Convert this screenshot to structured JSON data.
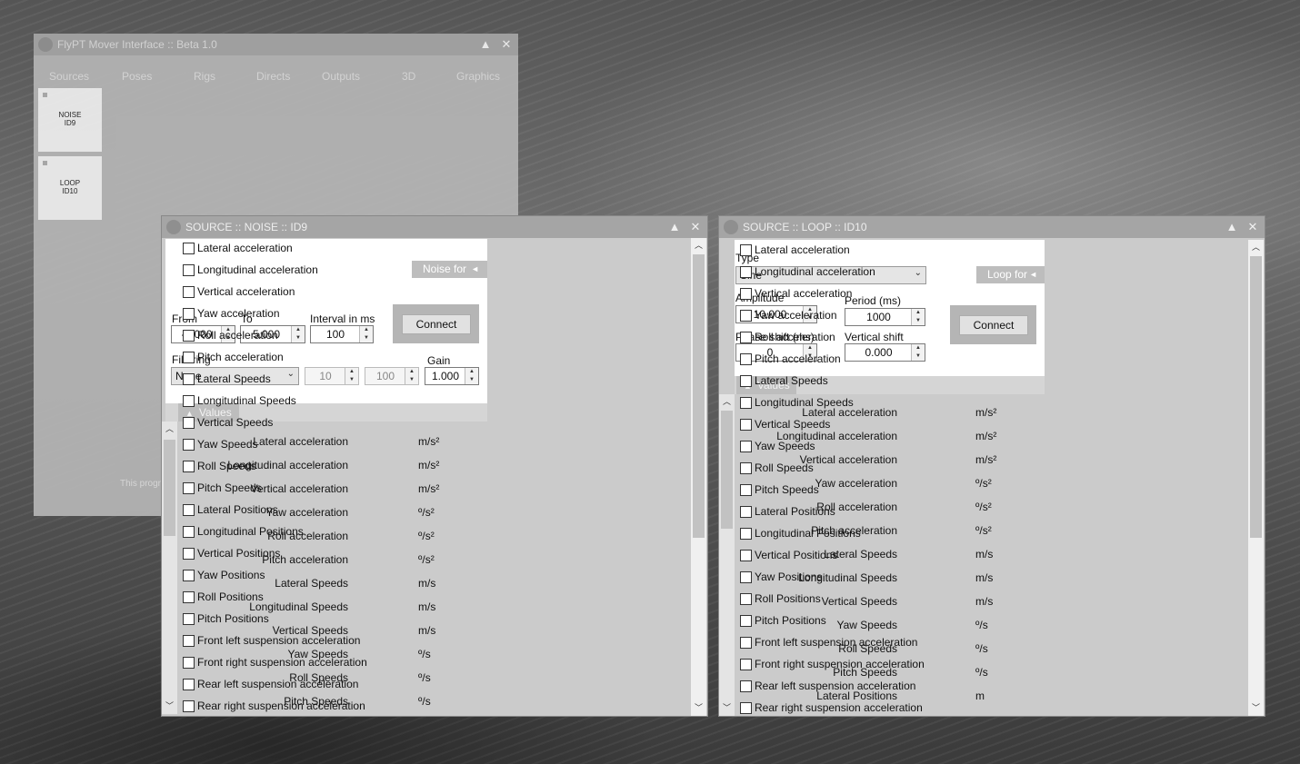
{
  "main_window": {
    "title": "FlyPT Mover Interface :: Beta 1.0",
    "tabs": [
      "Sources",
      "Poses",
      "Rigs",
      "Directs",
      "Outputs",
      "3D",
      "Graphics"
    ],
    "sources": [
      {
        "line1": "NOISE",
        "line2": "ID9"
      },
      {
        "line1": "LOOP",
        "line2": "ID10"
      }
    ],
    "footer": "This progra"
  },
  "icons": {
    "up": "▲",
    "close": "✕",
    "down": "⌄",
    "triangle_left": "◄",
    "tri_up": "▲",
    "tri_down": "▼",
    "scroll_up": "︿",
    "scroll_down": "﹀"
  },
  "noise": {
    "title": "SOURCE :: NOISE :: ID9",
    "noise_for": "Noise for",
    "from_label": "From",
    "from": "-5.000",
    "to_label": "To",
    "to": "5.000",
    "interval_label": "Interval in ms",
    "interval": "100",
    "connect": "Connect",
    "filtering_label": "Filtering",
    "filtering": "None",
    "f1": "10",
    "f2": "100",
    "gain_label": "Gain",
    "gain": "1.000",
    "values_label": "Values",
    "rows": [
      [
        "Lateral acceleration",
        "m/s²"
      ],
      [
        "Longitudinal acceleration",
        "m/s²"
      ],
      [
        "Vertical acceleration",
        "m/s²"
      ],
      [
        "Yaw acceleration",
        "º/s²"
      ],
      [
        "Roll acceleration",
        "º/s²"
      ],
      [
        "Pitch acceleration",
        "º/s²"
      ],
      [
        "Lateral Speeds",
        "m/s"
      ],
      [
        "Longitudinal Speeds",
        "m/s"
      ],
      [
        "Vertical Speeds",
        "m/s"
      ],
      [
        "Yaw Speeds",
        "º/s"
      ],
      [
        "Roll Speeds",
        "º/s"
      ],
      [
        "Pitch Speeds",
        "º/s"
      ]
    ]
  },
  "loop": {
    "title": "SOURCE :: LOOP :: ID10",
    "type_label": "Type",
    "type": "Sine",
    "loop_for": "Loop for",
    "amplitude_label": "Amplitude",
    "amplitude": "10.000",
    "period_label": "Period (ms)",
    "period": "1000",
    "connect": "Connect",
    "phase_label": "Phase shift (ms)",
    "phase": "0",
    "vshift_label": "Vertical shift",
    "vshift": "0.000",
    "values_label": "Values",
    "rows": [
      [
        "Lateral acceleration",
        "m/s²"
      ],
      [
        "Longitudinal acceleration",
        "m/s²"
      ],
      [
        "Vertical acceleration",
        "m/s²"
      ],
      [
        "Yaw acceleration",
        "º/s²"
      ],
      [
        "Roll acceleration",
        "º/s²"
      ],
      [
        "Pitch acceleration",
        "º/s²"
      ],
      [
        "Lateral Speeds",
        "m/s"
      ],
      [
        "Longitudinal Speeds",
        "m/s"
      ],
      [
        "Vertical Speeds",
        "m/s"
      ],
      [
        "Yaw Speeds",
        "º/s"
      ],
      [
        "Roll Speeds",
        "º/s"
      ],
      [
        "Pitch Speeds",
        "º/s"
      ],
      [
        "Lateral Positions",
        "m"
      ]
    ]
  },
  "checks": [
    "Lateral acceleration",
    "Longitudinal acceleration",
    "Vertical acceleration",
    "Yaw acceleration",
    "Roll acceleration",
    "Pitch acceleration",
    "Lateral Speeds",
    "Longitudinal Speeds",
    "Vertical Speeds",
    "Yaw Speeds",
    "Roll Speeds",
    "Pitch Speeds",
    "Lateral Positions",
    "Longitudinal Positions",
    "Vertical Positions",
    "Yaw Positions",
    "Roll Positions",
    "Pitch Positions",
    "Front left suspension acceleration",
    "Front right suspension acceleration",
    "Rear left suspension acceleration",
    "Rear right suspension acceleration"
  ]
}
